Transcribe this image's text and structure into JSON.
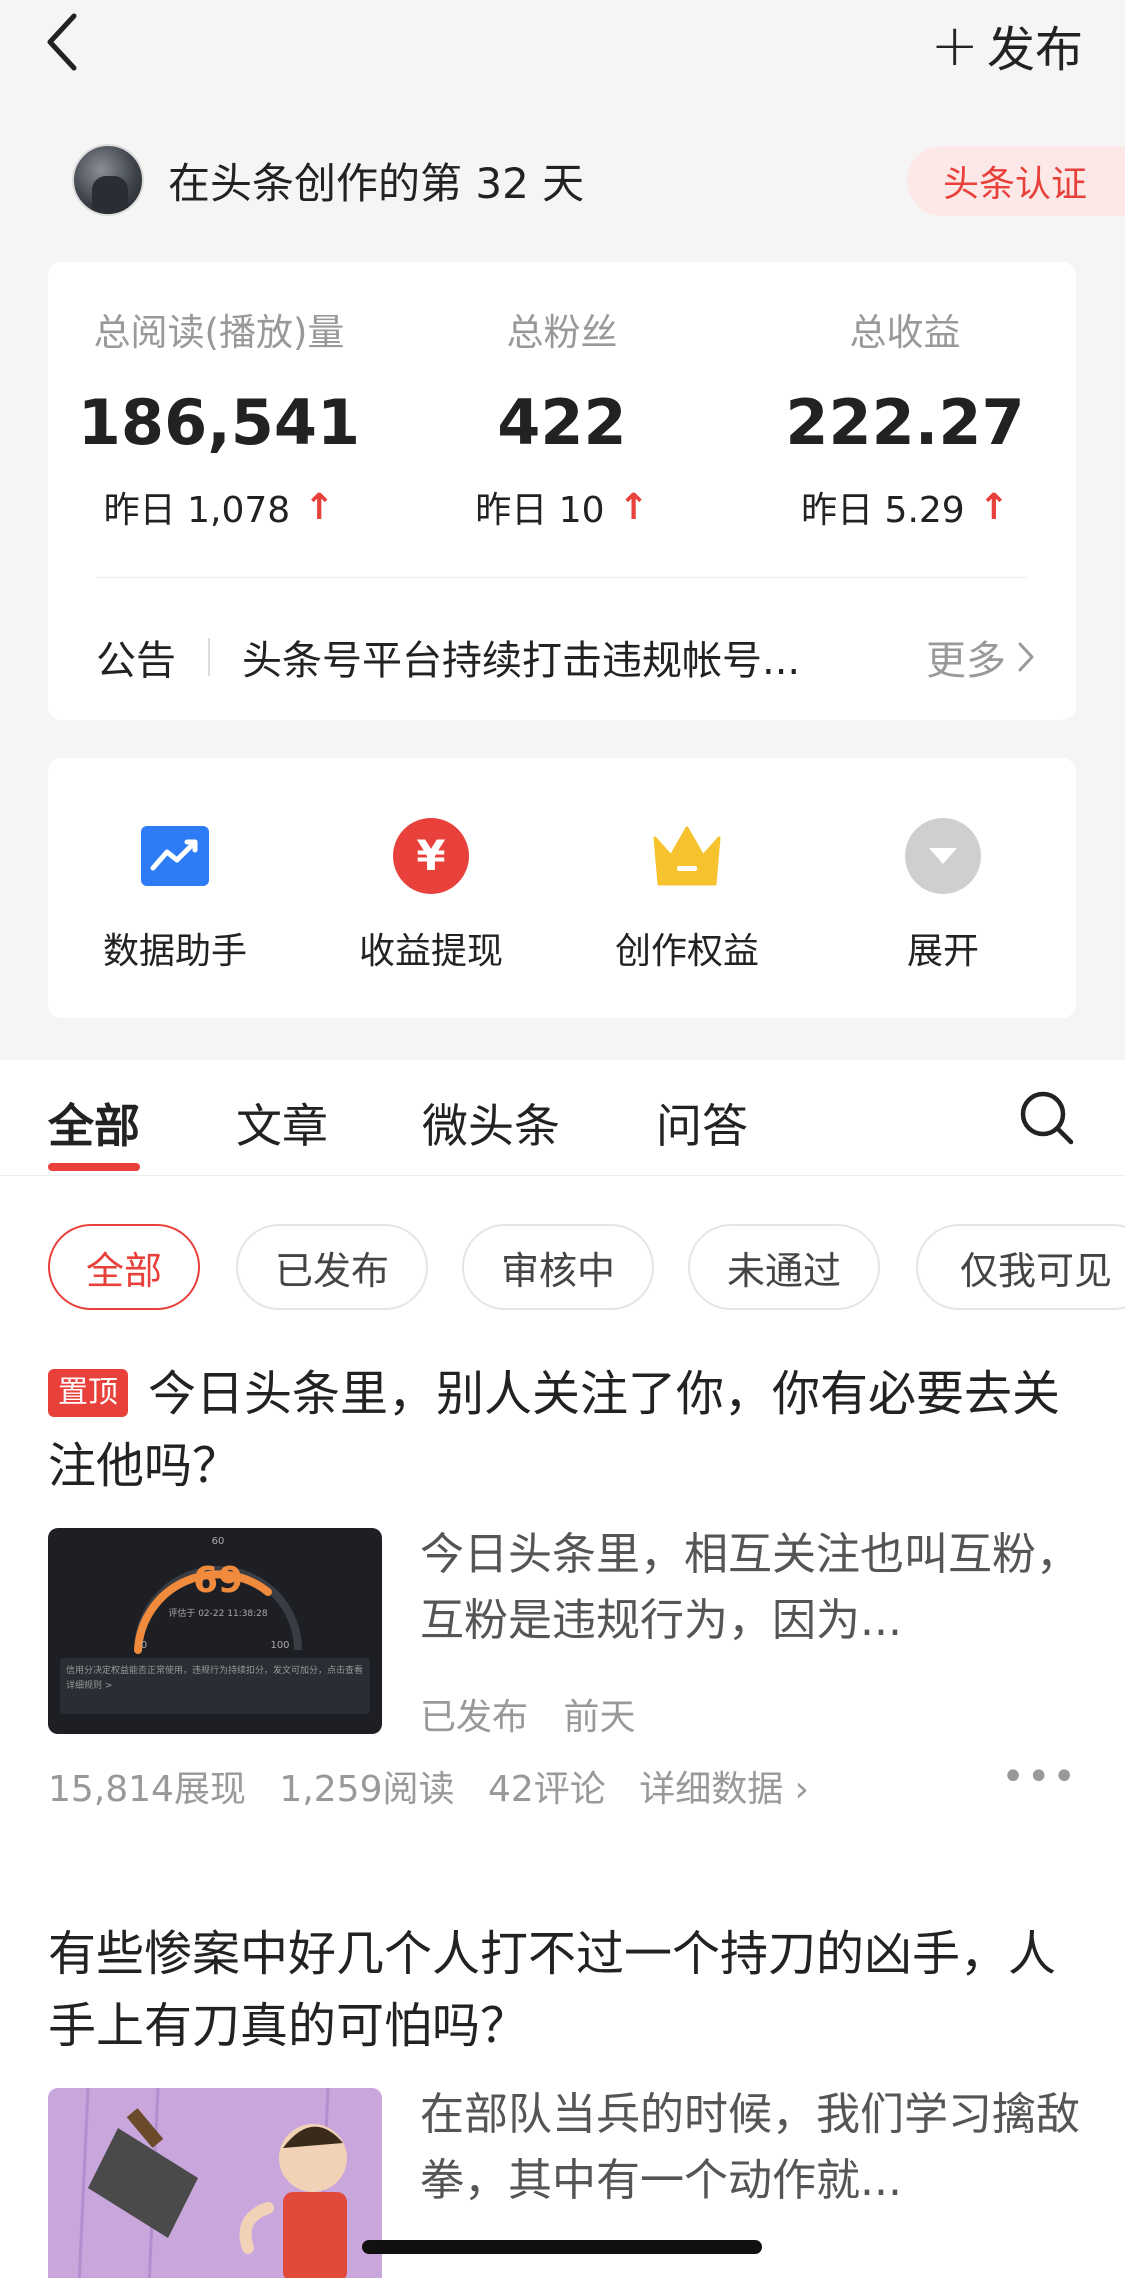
{
  "nav": {
    "publish_label": "发布"
  },
  "header": {
    "creator_days": "在头条创作的第 32 天",
    "cert_label": "头条认证"
  },
  "stats": [
    {
      "label": "总阅读(播放)量",
      "value": "186,541",
      "yesterday": "昨日 1,078"
    },
    {
      "label": "总粉丝",
      "value": "422",
      "yesterday": "昨日 10"
    },
    {
      "label": "总收益",
      "value": "222.27",
      "yesterday": "昨日 5.29"
    }
  ],
  "notice": {
    "label": "公告",
    "text": "头条号平台持续打击违规帐号...",
    "more": "更多"
  },
  "tools": [
    {
      "label": "数据助手",
      "icon": "chart-icon",
      "color": "#2d7cf6"
    },
    {
      "label": "收益提现",
      "icon": "yuan-icon",
      "color": "#e8413b",
      "glyph": "¥"
    },
    {
      "label": "创作权益",
      "icon": "crown-icon",
      "color": "#f6c32e"
    },
    {
      "label": "展开",
      "icon": "expand-icon",
      "color": "#cfcfcf"
    }
  ],
  "tabs": [
    "全部",
    "文章",
    "微头条",
    "问答"
  ],
  "filters": [
    "全部",
    "已发布",
    "审核中",
    "未通过",
    "仅我可见"
  ],
  "articles": [
    {
      "pin": "置顶",
      "title": "今日头条里，别人关注了你，你有必要去关注他吗？",
      "excerpt": "今日头条里，相互关注也叫互粉，互粉是违规行为，因为...",
      "status": "已发布",
      "time": "前天",
      "thumb": {
        "score": "69",
        "top_label": "60",
        "left_label": "0",
        "right_label": "100",
        "date": "评估于 02-22 11:38:28",
        "desc": "信用分决定权益能否正常使用，违规行为持续扣分，发文可加分，点击查看详细规则 >"
      },
      "impressions": "15,814展现",
      "reads": "1,259阅读",
      "comments": "42评论",
      "detail": "详细数据"
    },
    {
      "title": "有些惨案中好几个人打不过一个持刀的凶手，人手上有刀真的可怕吗？",
      "excerpt": "在部队当兵的时候，我们学习擒敌拳，其中有一个动作就..."
    }
  ]
}
